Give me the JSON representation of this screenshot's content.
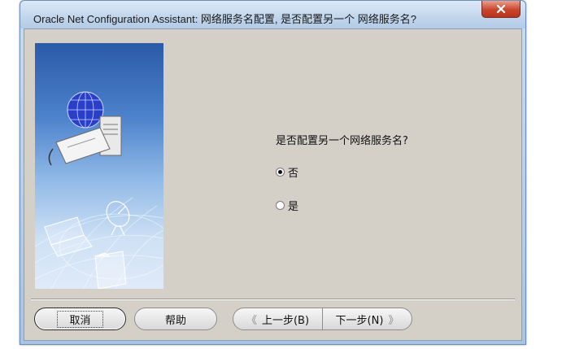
{
  "window": {
    "title": "Oracle Net Configuration Assistant: 网络服务名配置, 是否配置另一个 网络服务名?"
  },
  "main": {
    "question": "是否配置另一个网络服务名?",
    "options": [
      {
        "label": "否",
        "selected": true
      },
      {
        "label": "是",
        "selected": false
      }
    ]
  },
  "buttons": {
    "cancel": "取消",
    "help": "帮助",
    "back": "上一步(B)",
    "next": "下一步(N)",
    "back_arrow": "《",
    "next_arrow": "》"
  },
  "colors": {
    "dialog_bg": "#d4d0c8",
    "title_bar": "#c3d7ed",
    "close_button": "#c9452c",
    "side_image_top": "#2b5aa8"
  },
  "icons": [
    "close-icon",
    "globe-icon",
    "server-icon",
    "satellite-dish-icon",
    "laptop-icon",
    "folder-icon"
  ]
}
